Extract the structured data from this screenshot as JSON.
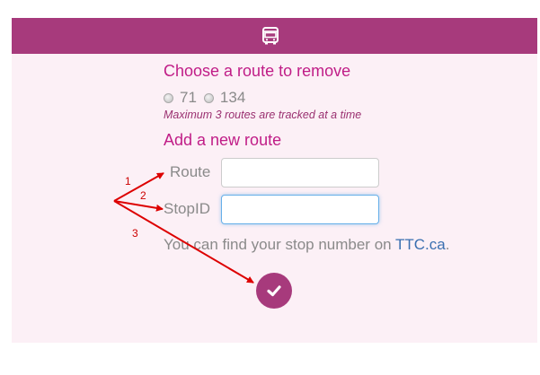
{
  "header": {
    "icon": "bus-icon",
    "background": "#a73a7c"
  },
  "remove_section": {
    "title": "Choose a route to remove",
    "routes": [
      {
        "label": "71",
        "selected": false
      },
      {
        "label": "134",
        "selected": false
      }
    ],
    "hint": "Maximum 3 routes are tracked at a time"
  },
  "add_section": {
    "title": "Add a new route",
    "route_label": "Route",
    "route_value": "",
    "stop_label": "StopID",
    "stop_value": ""
  },
  "info": {
    "text": "You can find your stop number on ",
    "link_text": "TTC.ca",
    "suffix": "."
  },
  "submit": {
    "icon": "checkmark-icon"
  },
  "annotations": {
    "labels": [
      "1",
      "2",
      "3"
    ],
    "color": "#dd0000"
  },
  "colors": {
    "accent": "#a73a7c",
    "heading": "#c01d87",
    "background": "#fcf0f6",
    "link": "#3a6fb0"
  }
}
